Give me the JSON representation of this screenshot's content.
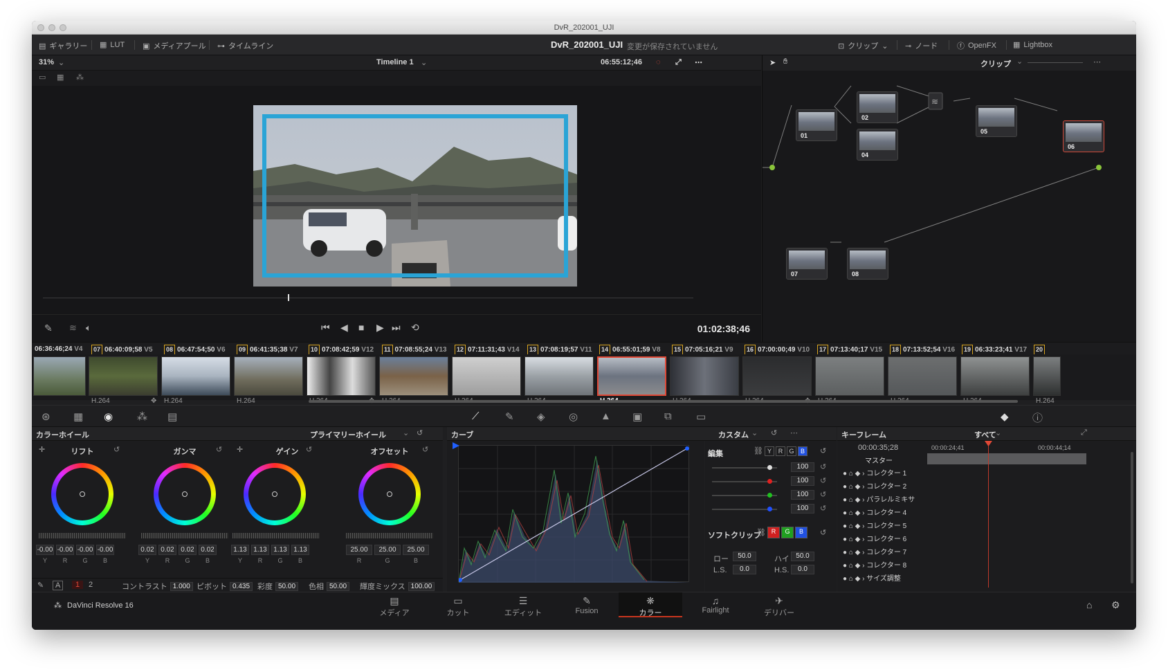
{
  "window": {
    "title": "DvR_202001_UJI"
  },
  "topbar": {
    "gallery": "ギャラリー",
    "lut": "LUT",
    "media_pool": "メディアプール",
    "timeline": "タイムライン",
    "project_title": "DvR_202001_UJI",
    "save_status": "変更が保存されていません",
    "clip": "クリップ",
    "nodes": "ノード",
    "openfx": "OpenFX",
    "lightbox": "Lightbox"
  },
  "viewer": {
    "zoom": "31%",
    "timeline_name": "Timeline 1",
    "timecode": "06:55:12;46",
    "playhead_tc": "01:02:38;46"
  },
  "node_panel": {
    "mode": "クリップ",
    "nodes": [
      "01",
      "02",
      "04",
      "05",
      "06",
      "07",
      "08"
    ]
  },
  "clips": [
    {
      "num": "",
      "tc": "06:36:46;24",
      "track": "V4",
      "codec": ""
    },
    {
      "num": "07",
      "tc": "06:40:09;58",
      "track": "V5",
      "codec": "H.264"
    },
    {
      "num": "08",
      "tc": "06:47:54;50",
      "track": "V6",
      "codec": "H.264"
    },
    {
      "num": "09",
      "tc": "06:41:35;38",
      "track": "V7",
      "codec": "H.264"
    },
    {
      "num": "10",
      "tc": "07:08:42;59",
      "track": "V12",
      "codec": "H.264"
    },
    {
      "num": "11",
      "tc": "07:08:55;24",
      "track": "V13",
      "codec": "H.264"
    },
    {
      "num": "12",
      "tc": "07:11:31;43",
      "track": "V14",
      "codec": "H.264"
    },
    {
      "num": "13",
      "tc": "07:08:19;57",
      "track": "V11",
      "codec": "H.264"
    },
    {
      "num": "14",
      "tc": "06:55:01;59",
      "track": "V8",
      "codec": "H.264"
    },
    {
      "num": "15",
      "tc": "07:05:16;21",
      "track": "V9",
      "codec": "H.264"
    },
    {
      "num": "16",
      "tc": "07:00:00;49",
      "track": "V10",
      "codec": "H.264"
    },
    {
      "num": "17",
      "tc": "07:13:40;17",
      "track": "V15",
      "codec": "H.264"
    },
    {
      "num": "18",
      "tc": "07:13:52;54",
      "track": "V16",
      "codec": "H.264"
    },
    {
      "num": "19",
      "tc": "06:33:23;41",
      "track": "V17",
      "codec": "H.264"
    },
    {
      "num": "20",
      "tc": "",
      "track": "",
      "codec": "H.264"
    }
  ],
  "wheels": {
    "panel_title": "カラーホイール",
    "mode": "プライマリーホイール",
    "items": [
      {
        "label": "リフト",
        "values": [
          "-0.00",
          "-0.00",
          "-0.00",
          "-0.00"
        ],
        "channels": [
          "Y",
          "R",
          "G",
          "B"
        ]
      },
      {
        "label": "ガンマ",
        "values": [
          "0.02",
          "0.02",
          "0.02",
          "0.02"
        ],
        "channels": [
          "Y",
          "R",
          "G",
          "B"
        ]
      },
      {
        "label": "ゲイン",
        "values": [
          "1.13",
          "1.13",
          "1.13",
          "1.13"
        ],
        "channels": [
          "Y",
          "R",
          "G",
          "B"
        ]
      },
      {
        "label": "オフセット",
        "values": [
          "25.00",
          "25.00",
          "25.00"
        ],
        "channels": [
          "R",
          "G",
          "B"
        ]
      }
    ]
  },
  "params": {
    "page1": "1",
    "page2": "2",
    "contrast_label": "コントラスト",
    "contrast": "1.000",
    "pivot_label": "ピボット",
    "pivot": "0.435",
    "sat_label": "彩度",
    "sat": "50.00",
    "hue_label": "色相",
    "hue": "50.00",
    "lummix_label": "輝度ミックス",
    "lummix": "100.00"
  },
  "curves": {
    "title": "カーブ",
    "mode": "カスタム"
  },
  "edit": {
    "title": "編集",
    "values": [
      "100",
      "100",
      "100",
      "100"
    ],
    "soft_clip": "ソフトクリップ",
    "low_label": "ロー",
    "low": "50.0",
    "high_label": "ハイ",
    "high": "50.0",
    "ls_label": "L.S.",
    "ls": "0.0",
    "hs_label": "H.S.",
    "hs": "0.0"
  },
  "keyframes": {
    "title": "キーフレーム",
    "filter": "すべて",
    "tc_current": "00:00:35;28",
    "tc_mark1": "00:00:24;41",
    "tc_mark2": "00:00:44;14",
    "master": "マスター",
    "rows": [
      "コレクター 1",
      "コレクター 2",
      "パラレルミキサ",
      "コレクター 4",
      "コレクター 5",
      "コレクター 6",
      "コレクター 7",
      "コレクター 8",
      "サイズ調整"
    ]
  },
  "nav": {
    "app_name": "DaVinci Resolve 16",
    "pages": [
      "メディア",
      "カット",
      "エディット",
      "Fusion",
      "カラー",
      "Fairlight",
      "デリバー"
    ]
  },
  "colors": {
    "accent_red": "#e04836",
    "selection_box": "#2aa4d6",
    "node_green": "#8ac43a",
    "node_blue": "#2ea8e0"
  }
}
